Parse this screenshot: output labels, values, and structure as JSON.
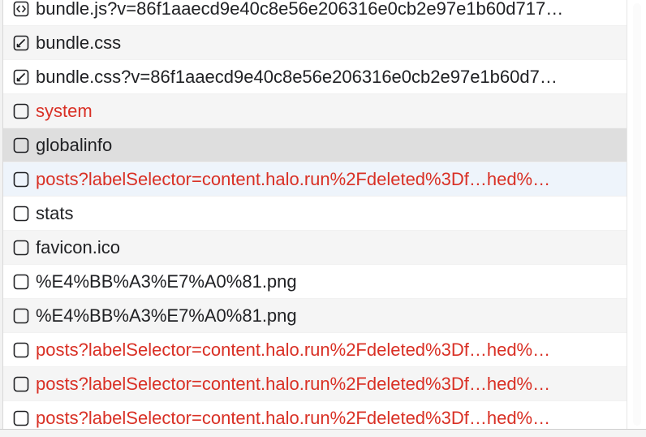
{
  "requests": [
    {
      "name": "bundle.js?v=86f1aaecd9e40c8e56e206316e0cb2e97e1b60d717…",
      "type": "script",
      "icon": "script-icon",
      "status": "ok"
    },
    {
      "name": "bundle.css",
      "type": "stylesheet",
      "icon": "stylesheet-icon",
      "status": "ok"
    },
    {
      "name": "bundle.css?v=86f1aaecd9e40c8e56e206316e0cb2e97e1b60d7…",
      "type": "stylesheet",
      "icon": "stylesheet-icon",
      "status": "ok"
    },
    {
      "name": "system",
      "type": "document",
      "icon": "document-icon",
      "status": "error"
    },
    {
      "name": "globalinfo",
      "type": "document",
      "icon": "document-icon",
      "status": "ok"
    },
    {
      "name": "posts?labelSelector=content.halo.run%2Fdeleted%3Df…hed%…",
      "type": "document",
      "icon": "document-icon",
      "status": "error"
    },
    {
      "name": "stats",
      "type": "document",
      "icon": "document-icon",
      "status": "ok"
    },
    {
      "name": "favicon.ico",
      "type": "document",
      "icon": "document-icon",
      "status": "ok"
    },
    {
      "name": "%E4%BB%A3%E7%A0%81.png",
      "type": "document",
      "icon": "document-icon",
      "status": "ok"
    },
    {
      "name": "%E4%BB%A3%E7%A0%81.png",
      "type": "document",
      "icon": "document-icon",
      "status": "ok"
    },
    {
      "name": "posts?labelSelector=content.halo.run%2Fdeleted%3Df…hed%…",
      "type": "document",
      "icon": "document-icon",
      "status": "error"
    },
    {
      "name": "posts?labelSelector=content.halo.run%2Fdeleted%3Df…hed%…",
      "type": "document",
      "icon": "document-icon",
      "status": "error"
    },
    {
      "name": "posts?labelSelector=content.halo.run%2Fdeleted%3Df…hed%…",
      "type": "document",
      "icon": "document-icon",
      "status": "error"
    }
  ],
  "selected_index": 4,
  "hover_index": 5,
  "colors": {
    "error_text": "#d93025",
    "normal_text": "#202124",
    "selected_row": "#dedede",
    "hover_row": "#eef4fb",
    "striped_row": "#f5f5f5"
  }
}
